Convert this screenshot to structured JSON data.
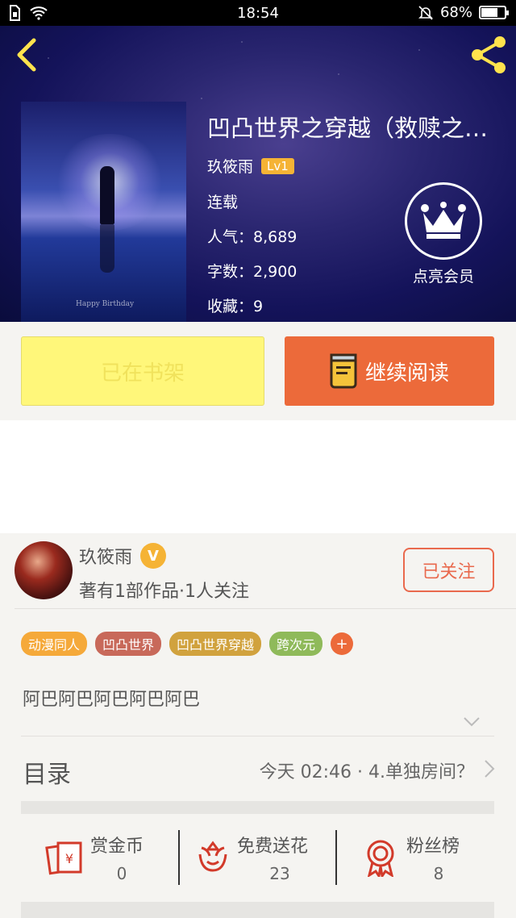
{
  "status_bar": {
    "time": "18:54",
    "battery": "68%",
    "battery_level": 0.68
  },
  "book": {
    "title": "凹凸世界之穿越（救赎之…",
    "author": "玖筱雨",
    "level": "Lv1",
    "status": "连载",
    "popularity": "人气：8,689",
    "word_count": "字数：2,900",
    "favorites": "收藏：9",
    "cover_caption": "Happy Birthday"
  },
  "vip": {
    "label": "点亮会员"
  },
  "actions": {
    "shelf_label": "已在书架",
    "read_label": "继续阅读"
  },
  "author_panel": {
    "name": "玖筱雨",
    "verified_badge": "V",
    "subtitle": "著有1部作品·1人关注",
    "follow_label": "已关注"
  },
  "tags": [
    {
      "label": "动漫同人",
      "color": "#f5a93a"
    },
    {
      "label": "凹凸世界",
      "color": "#c8695a"
    },
    {
      "label": "凹凸世界穿越",
      "color": "#d1a23e"
    },
    {
      "label": "跨次元",
      "color": "#8fba5a"
    }
  ],
  "tag_add": "+",
  "description": "阿巴阿巴阿巴阿巴阿巴",
  "toc": {
    "label": "目录",
    "latest": "今天 02:46 · 4.单独房间？"
  },
  "stats": [
    {
      "label": "赏金币",
      "value": "0",
      "icon": "red-envelope-icon"
    },
    {
      "label": "免费送花",
      "value": "23",
      "icon": "flower-icon"
    },
    {
      "label": "粉丝榜",
      "value": "8",
      "icon": "medal-icon"
    }
  ],
  "colors": {
    "accent": "#ec6a3a",
    "shelf_button": "#fff77a",
    "follow": "#e9694d",
    "badge": "#f5b335"
  }
}
